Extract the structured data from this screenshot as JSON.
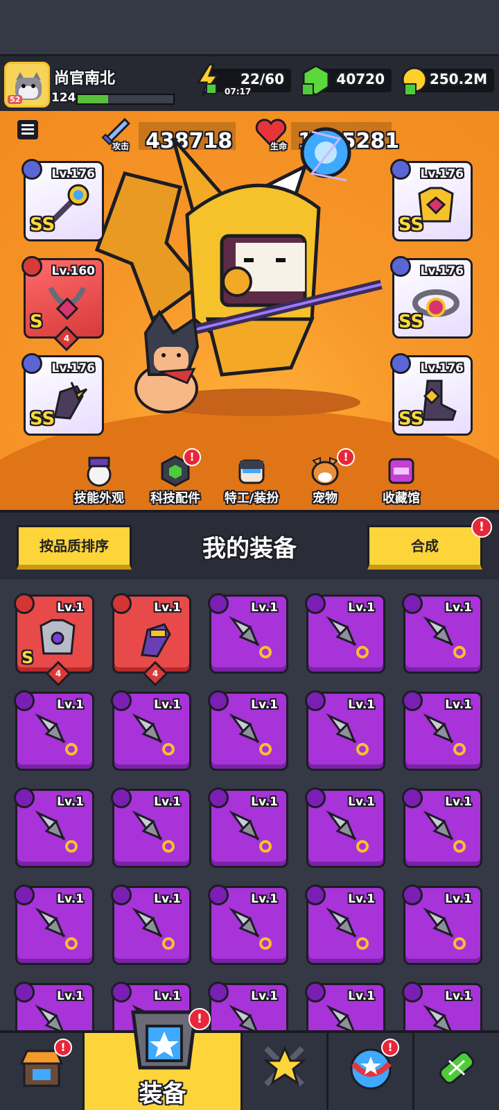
{
  "player": {
    "name": "尚官南北",
    "level": "124",
    "avatar_badge": "52",
    "xp_percent": 32
  },
  "resources": {
    "energy": {
      "value": "22/60",
      "timer": "07:17",
      "icon": "lightning-icon"
    },
    "gems": {
      "value": "40720",
      "icon": "green-gem-icon"
    },
    "gold": {
      "value": "250.2M",
      "icon": "gold-coin-icon"
    }
  },
  "stats": {
    "attack": {
      "label": "攻击",
      "value": "438718",
      "icon": "sword-icon"
    },
    "health": {
      "label": "生命",
      "value": "1655281",
      "icon": "heart-icon"
    }
  },
  "equipped": [
    {
      "slot": "weapon",
      "level": "Lv.176",
      "rarity": "SS",
      "color": "white",
      "icon": "staff-icon",
      "tag_icon": "weapon-slot-icon"
    },
    {
      "slot": "armor",
      "level": "Lv.176",
      "rarity": "SS",
      "color": "white",
      "icon": "armor-icon",
      "tag_icon": "armor-slot-icon"
    },
    {
      "slot": "necklace",
      "level": "Lv.160",
      "rarity": "S",
      "color": "red",
      "stars": "4",
      "icon": "necklace-icon",
      "tag_icon": "necklace-slot-icon"
    },
    {
      "slot": "belt",
      "level": "Lv.176",
      "rarity": "SS",
      "color": "white",
      "icon": "belt-icon",
      "tag_icon": "belt-slot-icon"
    },
    {
      "slot": "gloves",
      "level": "Lv.176",
      "rarity": "SS",
      "color": "white",
      "icon": "glove-icon",
      "tag_icon": "glove-slot-icon"
    },
    {
      "slot": "boots",
      "level": "Lv.176",
      "rarity": "SS",
      "color": "white",
      "icon": "boot-icon",
      "tag_icon": "boot-slot-icon"
    }
  ],
  "hero_tabs": [
    {
      "label": "技能外观",
      "icon": "skill-skin-icon",
      "alert": false
    },
    {
      "label": "科技配件",
      "icon": "tech-part-icon",
      "alert": true
    },
    {
      "label": "特工/装扮",
      "icon": "agent-icon",
      "alert": false
    },
    {
      "label": "宠物",
      "icon": "pet-icon",
      "alert": true
    },
    {
      "label": "收藏馆",
      "icon": "collection-icon",
      "alert": false
    }
  ],
  "equipment_panel": {
    "sort_label": "按品质排序",
    "title": "我的装备",
    "merge_label": "合成",
    "merge_alert": "!"
  },
  "inventory": [
    {
      "level": "Lv.1",
      "color": "red",
      "rarity": "S",
      "stars": "4",
      "icon": "armor-icon"
    },
    {
      "level": "Lv.1",
      "color": "red",
      "rarity": "",
      "stars": "4",
      "icon": "glove-icon"
    },
    {
      "level": "Lv.1",
      "color": "purple",
      "icon": "kunai-icon"
    },
    {
      "level": "Lv.1",
      "color": "purple",
      "icon": "kunai-icon"
    },
    {
      "level": "Lv.1",
      "color": "purple",
      "icon": "kunai-icon"
    },
    {
      "level": "Lv.1",
      "color": "purple",
      "icon": "kunai-icon"
    },
    {
      "level": "Lv.1",
      "color": "purple",
      "icon": "kunai-icon"
    },
    {
      "level": "Lv.1",
      "color": "purple",
      "icon": "kunai-icon"
    },
    {
      "level": "Lv.1",
      "color": "purple",
      "icon": "kunai-icon"
    },
    {
      "level": "Lv.1",
      "color": "purple",
      "icon": "kunai-icon"
    },
    {
      "level": "Lv.1",
      "color": "purple",
      "icon": "kunai-icon"
    },
    {
      "level": "Lv.1",
      "color": "purple",
      "icon": "kunai-icon"
    },
    {
      "level": "Lv.1",
      "color": "purple",
      "icon": "kunai-icon"
    },
    {
      "level": "Lv.1",
      "color": "purple",
      "icon": "kunai-icon"
    },
    {
      "level": "Lv.1",
      "color": "purple",
      "icon": "kunai-icon"
    },
    {
      "level": "Lv.1",
      "color": "purple",
      "icon": "kunai-icon"
    },
    {
      "level": "Lv.1",
      "color": "purple",
      "icon": "kunai-icon"
    },
    {
      "level": "Lv.1",
      "color": "purple",
      "icon": "kunai-icon"
    },
    {
      "level": "Lv.1",
      "color": "purple",
      "icon": "kunai-icon"
    },
    {
      "level": "Lv.1",
      "color": "purple",
      "icon": "kunai-icon"
    },
    {
      "level": "Lv.1",
      "color": "purple",
      "icon": "kunai-icon"
    },
    {
      "level": "Lv.1",
      "color": "purple",
      "icon": "kunai-icon"
    },
    {
      "level": "Lv.1",
      "color": "purple",
      "icon": "kunai-icon"
    },
    {
      "level": "Lv.1",
      "color": "purple",
      "icon": "kunai-icon"
    },
    {
      "level": "Lv.1",
      "color": "purple",
      "icon": "kunai-icon"
    }
  ],
  "bottom_nav": [
    {
      "icon": "shop-icon",
      "alert": true,
      "label": ""
    },
    {
      "icon": "equipment-icon",
      "alert": true,
      "label": "装备",
      "active": true
    },
    {
      "icon": "battle-icon",
      "alert": false,
      "label": ""
    },
    {
      "icon": "evolve-icon",
      "alert": true,
      "label": ""
    },
    {
      "icon": "dna-icon",
      "alert": false,
      "label": ""
    }
  ],
  "colors": {
    "purple": "#a733d9",
    "red": "#e84a4a",
    "yellow": "#fdd43a",
    "orange": "#f7982a"
  }
}
